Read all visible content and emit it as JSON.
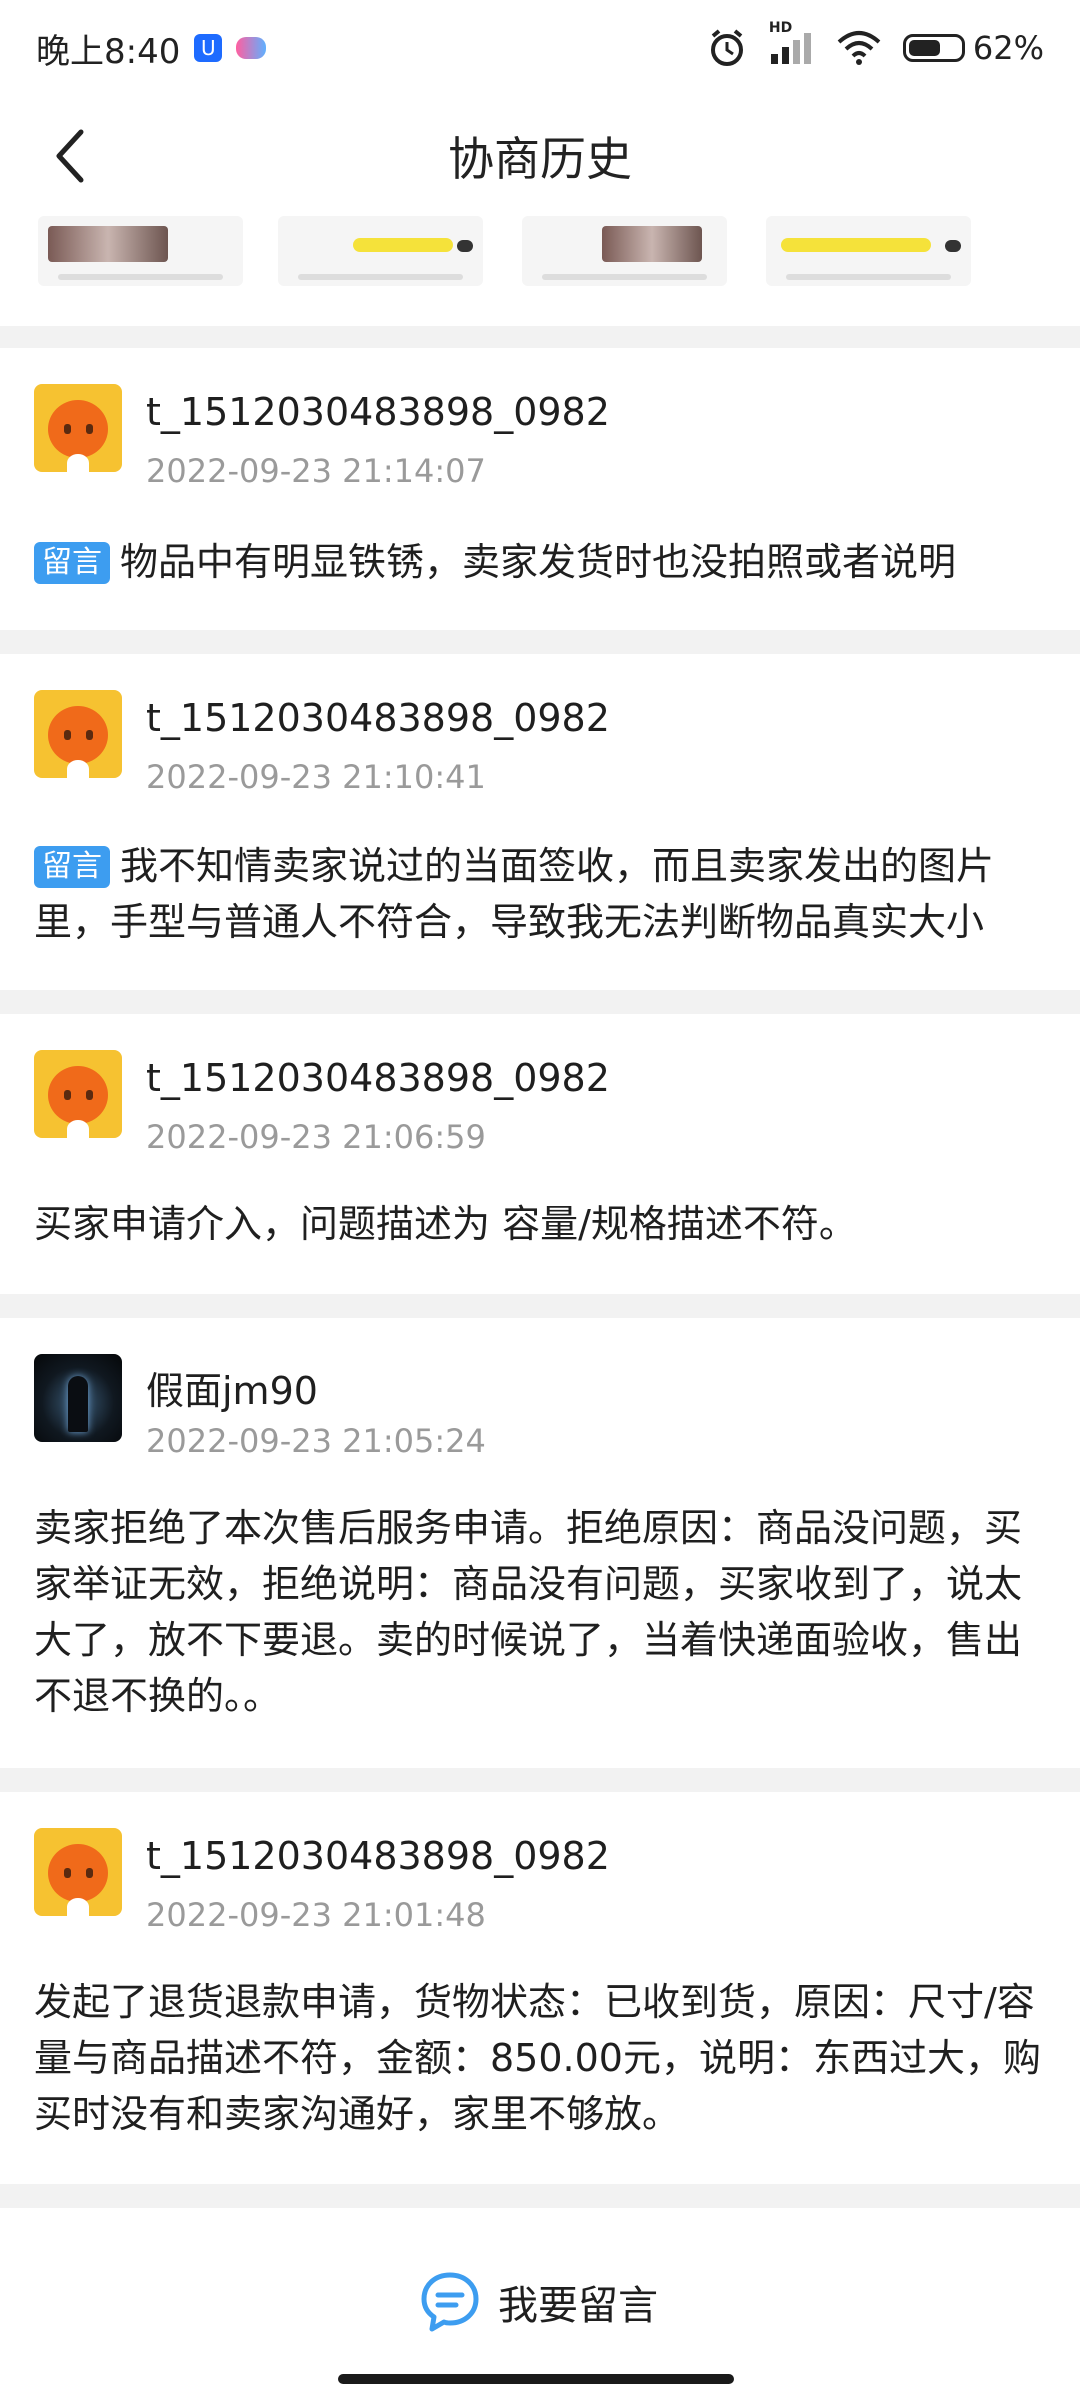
{
  "status_bar": {
    "time": "晚上8:40",
    "hd_label": "HD",
    "battery_percent": "62%",
    "battery_level": 0.62
  },
  "header": {
    "title": "协商历史",
    "back_icon": "back-arrow-icon"
  },
  "records": [
    {
      "username": "t_1512030483898_0982",
      "timestamp": "2022-09-23 21:14:07",
      "tag": "留言",
      "text": "物品中有明显铁锈，卖家发货时也没拍照或者说明",
      "avatar": "orange-mascot-avatar"
    },
    {
      "username": "t_1512030483898_0982",
      "timestamp": "2022-09-23 21:10:41",
      "tag": "留言",
      "text": "我不知情卖家说过的当面签收，而且卖家发出的图片里，手型与普通人不符合，导致我无法判断物品真实大小",
      "avatar": "orange-mascot-avatar"
    },
    {
      "username": "t_1512030483898_0982",
      "timestamp": "2022-09-23 21:06:59",
      "text": "买家申请介入，问题描述为 容量/规格描述不符。",
      "avatar": "orange-mascot-avatar"
    },
    {
      "username": "假面jm90",
      "timestamp": "2022-09-23 21:05:24",
      "text": "卖家拒绝了本次售后服务申请。拒绝原因：商品没问题，买家举证无效，拒绝说明：商品没有问题，买家收到了，说太大了，放不下要退。卖的时候说了，当着快递面验收，售出不退不换的。。",
      "avatar": "dark-figure-avatar"
    },
    {
      "username": "t_1512030483898_0982",
      "timestamp": "2022-09-23 21:01:48",
      "text": "发起了退货退款申请，货物状态：已收到货，原因：尺寸/容量与商品描述不符，金额：850.00元，说明：东西过大，购买时没有和卖家沟通好，家里不够放。",
      "avatar": "orange-mascot-avatar"
    }
  ],
  "bottom": {
    "reply_label": "我要留言",
    "reply_icon": "chat-bubble-icon"
  },
  "colors": {
    "tag_blue": "#3d9df0",
    "timestamp_gray": "#9a9a9a",
    "page_bg": "#f2f2f2",
    "reply_icon_blue": "#3d9df0"
  }
}
